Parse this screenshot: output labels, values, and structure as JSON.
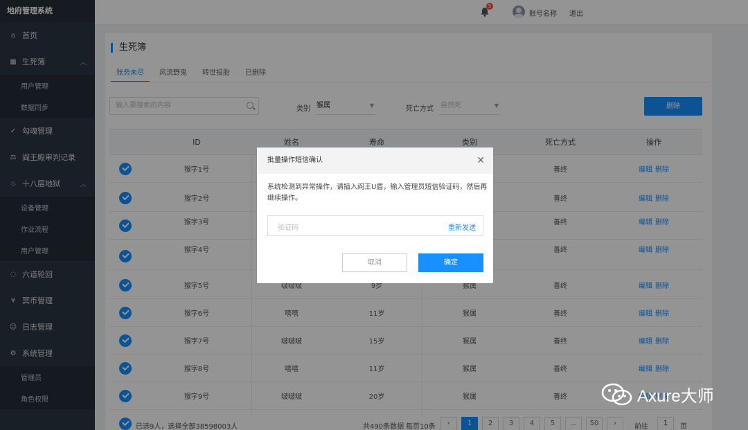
{
  "app": {
    "title": "地府管理系统"
  },
  "sidebar": {
    "items": [
      {
        "label": "首页",
        "icon": "home-icon"
      },
      {
        "label": "生死簿",
        "icon": "grid-icon",
        "expanded": true,
        "children": [
          "用户管理",
          "数据同步"
        ]
      },
      {
        "label": "勾魂管理",
        "icon": "check-icon"
      },
      {
        "label": "阎王殿审判记录",
        "icon": "scale-icon"
      },
      {
        "label": "十八层地狱",
        "icon": "fire-icon",
        "expanded": true,
        "children": [
          "设备管理",
          "作业流程",
          "用户管理"
        ]
      },
      {
        "label": "六道轮回",
        "icon": "cycle-icon"
      },
      {
        "label": "冥币管理",
        "icon": "money-icon"
      },
      {
        "label": "日志管理",
        "icon": "user-icon"
      },
      {
        "label": "系统管理",
        "icon": "settings-icon",
        "expanded": true,
        "children": [
          "管理员",
          "角色权限"
        ]
      }
    ]
  },
  "header": {
    "notification_count": "5",
    "account_name": "账号名称",
    "logout": "退出"
  },
  "page": {
    "title": "生死簿",
    "tabs": [
      "账务未尽",
      "风流野鬼",
      "转世投胎",
      "已删除"
    ],
    "active_tab": 0
  },
  "filters": {
    "search_placeholder": "输入要搜索的内容",
    "category_label": "类别",
    "category_value": "猴属",
    "death_label": "死亡方式",
    "death_value": "自然死",
    "delete_button": "删除"
  },
  "table": {
    "columns": [
      "ID",
      "姓名",
      "寿命",
      "类别",
      "死亡方式",
      "操作"
    ],
    "rows": [
      {
        "id": "猴字1号",
        "name": "",
        "life": "",
        "category": "",
        "death": "善终",
        "edit": "编辑",
        "del": "删除"
      },
      {
        "id": "猴字2号",
        "name": "",
        "life": "",
        "category": "",
        "death": "善终",
        "edit": "编辑",
        "del": "删除"
      },
      {
        "id": "猴字3号",
        "name": "",
        "life": "",
        "category": "",
        "death": "善终",
        "edit": "编辑",
        "del": "删除"
      },
      {
        "id": "猴字4号",
        "name": "",
        "life": "",
        "category": "",
        "death": "善终",
        "edit": "编辑",
        "del": "删除"
      },
      {
        "id": "猴字5号",
        "name": "啵啵啵",
        "life": "9岁",
        "category": "猴属",
        "death": "善终",
        "edit": "编辑",
        "del": "删除"
      },
      {
        "id": "猴字6号",
        "name": "嘻嘻",
        "life": "11岁",
        "category": "猴属",
        "death": "善终",
        "edit": "编辑",
        "del": "删除"
      },
      {
        "id": "猴字7号",
        "name": "啵啵啵",
        "life": "15岁",
        "category": "猴属",
        "death": "善终",
        "edit": "编辑",
        "del": "删除"
      },
      {
        "id": "猴字8号",
        "name": "嘻嘻",
        "life": "11岁",
        "category": "猴属",
        "death": "善终",
        "edit": "编辑",
        "del": "删除"
      },
      {
        "id": "猴字9号",
        "name": "啵啵啵",
        "life": "20岁",
        "category": "猴属",
        "death": "善终",
        "edit": "编辑",
        "del": "删除"
      }
    ]
  },
  "footer": {
    "selected_text": "已选9人，选择全部38598003人",
    "total": "共490条数据",
    "per_page": "每页10条",
    "prev": "‹",
    "pages": [
      "1",
      "2",
      "3",
      "4",
      "5",
      "...",
      "50"
    ],
    "next": "›",
    "jump_label": "前往",
    "jump_value": "1",
    "page_unit": "页"
  },
  "modal": {
    "title": "批量操作短信确认",
    "message": "系统检测到异常操作，请插入阎王U盾，输入管理员短信验证码，然后再继续操作。",
    "code_placeholder": "验证码",
    "resend": "重新发送",
    "cancel": "取消",
    "confirm": "确定"
  },
  "watermark": {
    "text": "Axure大师"
  },
  "colors": {
    "primary": "#1890ff",
    "sidebar": "#2b3642",
    "badge": "#f5533d"
  }
}
